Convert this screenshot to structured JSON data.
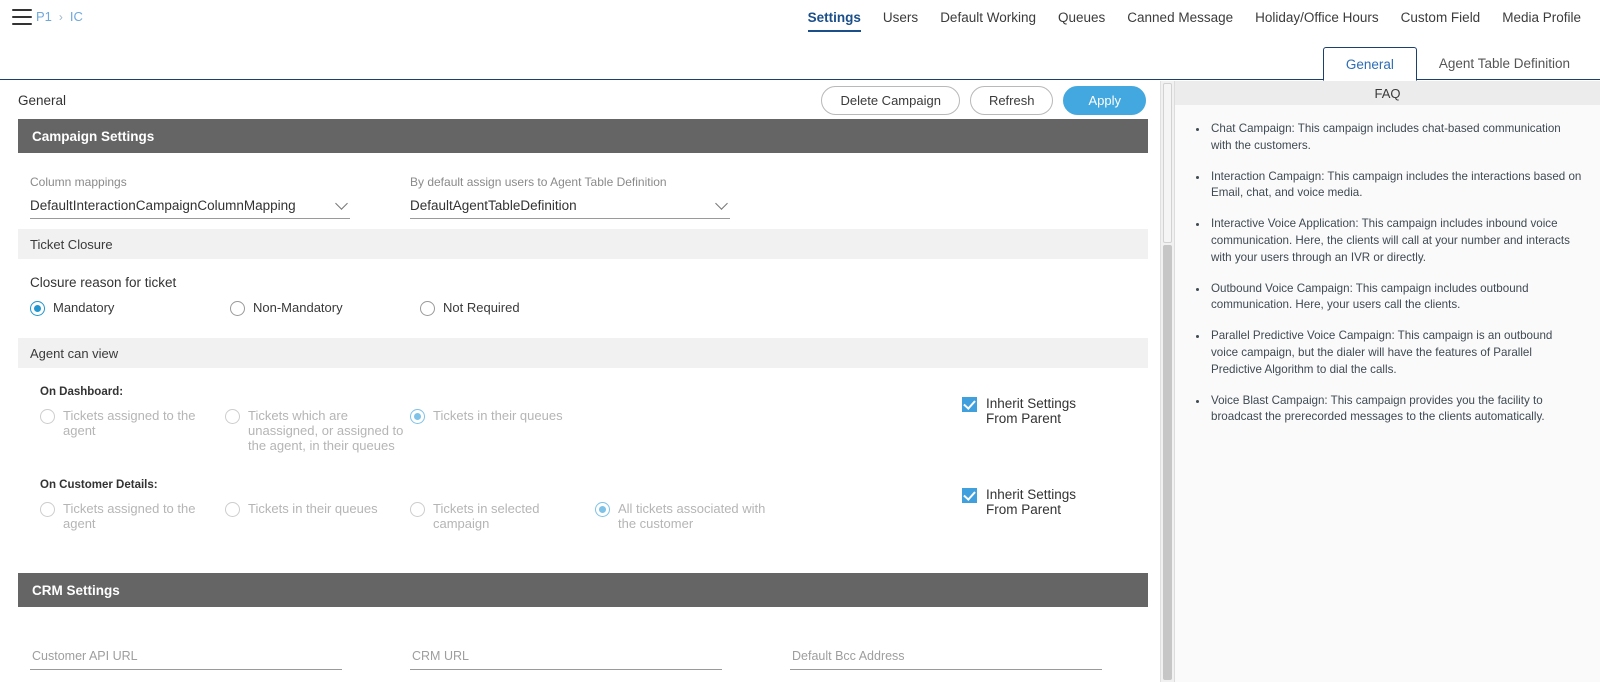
{
  "topbar": {
    "menu_icon": "hamburger-menu-icon",
    "breadcrumb": {
      "root": "P1",
      "separator": "›",
      "current": "IC"
    },
    "nav_items": [
      {
        "label": "Settings",
        "active": true
      },
      {
        "label": "Users",
        "active": false
      },
      {
        "label": "Default Working",
        "active": false
      },
      {
        "label": "Queues",
        "active": false
      },
      {
        "label": "Canned Message",
        "active": false
      },
      {
        "label": "Holiday/Office Hours",
        "active": false
      },
      {
        "label": "Custom Field",
        "active": false
      },
      {
        "label": "Media Profile",
        "active": false
      }
    ]
  },
  "subtabs": [
    {
      "label": "General",
      "active": true
    },
    {
      "label": "Agent Table Definition",
      "active": false
    }
  ],
  "page": {
    "title": "General",
    "buttons": {
      "delete": "Delete Campaign",
      "refresh": "Refresh",
      "apply": "Apply"
    }
  },
  "campaign_settings": {
    "heading": "Campaign Settings",
    "column_mappings": {
      "label": "Column mappings",
      "value": "DefaultInteractionCampaignColumnMapping"
    },
    "agent_table": {
      "label": "By default assign users to Agent Table Definition",
      "value": "DefaultAgentTableDefinition"
    }
  },
  "ticket_closure": {
    "heading": "Ticket Closure",
    "sub_heading": "Closure reason for ticket",
    "options": [
      {
        "label": "Mandatory",
        "checked": true
      },
      {
        "label": "Non-Mandatory",
        "checked": false
      },
      {
        "label": "Not Required",
        "checked": false
      }
    ]
  },
  "agent_can_view": {
    "heading": "Agent can view",
    "on_dashboard": {
      "label": "On Dashboard:",
      "options": [
        {
          "label": "Tickets assigned to the agent",
          "checked": false
        },
        {
          "label": "Tickets which are unassigned, or assigned to the agent, in their queues",
          "checked": false
        },
        {
          "label": "Tickets in their queues",
          "checked": true
        }
      ],
      "inherit": {
        "label": "Inherit Settings From Parent",
        "checked": true
      }
    },
    "on_customer_details": {
      "label": "On Customer Details:",
      "options": [
        {
          "label": "Tickets assigned to the agent",
          "checked": false
        },
        {
          "label": "Tickets in their queues",
          "checked": false
        },
        {
          "label": "Tickets in selected campaign",
          "checked": false
        },
        {
          "label": "All tickets associated with the customer",
          "checked": true
        }
      ],
      "inherit": {
        "label": "Inherit Settings From Parent",
        "checked": true
      }
    }
  },
  "crm_settings": {
    "heading": "CRM Settings",
    "fields": [
      {
        "placeholder": "Customer API URL",
        "value": ""
      },
      {
        "placeholder": "CRM URL",
        "value": ""
      },
      {
        "placeholder": "Default Bcc Address",
        "value": ""
      }
    ]
  },
  "faq": {
    "title": "FAQ",
    "items": [
      "Chat Campaign: This campaign includes chat-based communication with the customers.",
      "Interaction Campaign: This campaign includes the interactions based on Email, chat, and voice media.",
      "Interactive Voice Application: This campaign includes inbound voice communication. Here, the clients will call at your number and interacts with your users through an IVR or directly.",
      "Outbound Voice Campaign: This campaign includes outbound communication. Here, your users call the clients.",
      "Parallel Predictive Voice Campaign: This campaign is an outbound voice campaign, but the dialer will have the features of Parallel Predictive Algorithm to dial the calls.",
      "Voice Blast Campaign: This campaign provides you the facility to broadcast the prerecorded messages to the clients automatically."
    ]
  },
  "colors": {
    "accent_blue": "#44a8e0",
    "nav_active": "#1b4f8a",
    "section_dark": "#656565",
    "breadcrumb_link": "#6fa8dc"
  }
}
